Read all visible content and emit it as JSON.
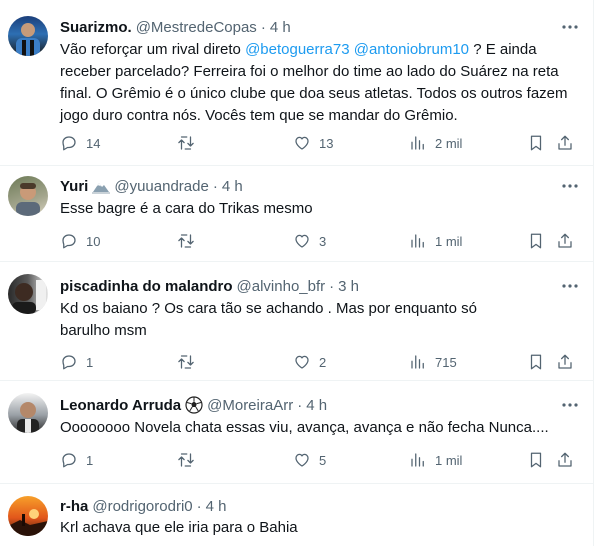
{
  "tweets": [
    {
      "name": "Suarizmo.",
      "handle": "@MestredeCopas",
      "dot": "·",
      "time": "4 h",
      "text_parts": [
        "Vão reforçar um rival direto ",
        "@betoguerra73",
        " ",
        "@antoniobrum10",
        " ? E ainda receber parcelado? Ferreira foi o melhor do time ao lado do Suárez na reta final. O Grêmio é o único clube que doa seus atletas. Todos os outros fazem jogo duro contra nós. Vocês tem que se mandar do Grêmio."
      ],
      "replies": "14",
      "retweets": "",
      "likes": "13",
      "views": "2 mil"
    },
    {
      "name": "Yuri",
      "handle": "@yuuandrade",
      "dot": "·",
      "time": "4 h",
      "text": "Esse bagre é a cara do Trikas mesmo",
      "replies": "10",
      "retweets": "",
      "likes": "3",
      "views": "1 mil"
    },
    {
      "name": "piscadinha do malandro",
      "handle": "@alvinho_bfr",
      "dot": "·",
      "time": "3 h",
      "text": "Kd os baiano ?  Os cara tão se achando . Mas por enquanto só barulho msm",
      "replies": "1",
      "retweets": "",
      "likes": "2",
      "views": "715"
    },
    {
      "name": "Leonardo Arruda",
      "handle": "@MoreiraArr",
      "dot": "·",
      "time": "4 h",
      "text": "Oooooooo Novela chata essas viu, avança, avança e não fecha Nunca....",
      "replies": "1",
      "retweets": "",
      "likes": "5",
      "views": "1 mil"
    },
    {
      "name": "r-ha",
      "handle": "@rodrigorodri0",
      "dot": "·",
      "time": "4 h",
      "text": "Krl achava que ele iria para o Bahia"
    }
  ],
  "icons": {
    "reply": "reply-icon",
    "retweet": "retweet-icon",
    "like": "heart-icon",
    "views": "views-icon",
    "bookmark": "bookmark-icon",
    "share": "share-icon",
    "more": "more-icon"
  },
  "colors": {
    "text": "#0f1419",
    "secondary": "#536471",
    "mention": "#1d9bf0",
    "divider": "#eff3f4"
  }
}
